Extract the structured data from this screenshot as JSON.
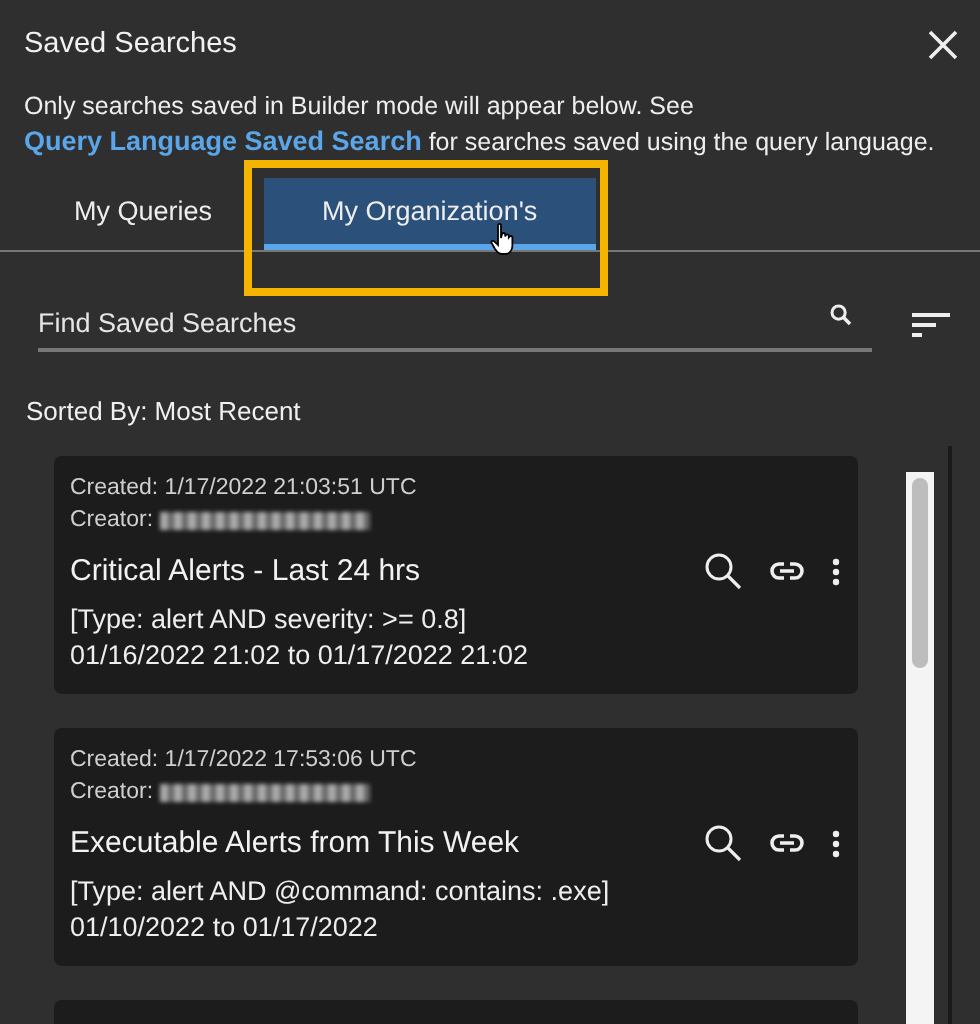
{
  "panel": {
    "title": "Saved Searches"
  },
  "notice": {
    "text": "Only searches saved in Builder mode will appear below. See ",
    "link": "Query Language Saved Search",
    "suffix": " for searches saved using the query language."
  },
  "tabs": [
    {
      "label": "My Queries",
      "selected": false
    },
    {
      "label": "My Organization's",
      "selected": true
    }
  ],
  "search": {
    "placeholder": "Find Saved Searches"
  },
  "sort_label": "Sorted By: Most Recent",
  "saved_searches": [
    {
      "created": "Created: 1/17/2022 21:03:51 UTC",
      "creator_label": "Creator:",
      "title": "Critical Alerts - Last 24 hrs",
      "query": "[Type: alert AND severity: >= 0.8]",
      "range": "01/16/2022 21:02 to 01/17/2022 21:02"
    },
    {
      "created": "Created: 1/17/2022 17:53:06 UTC",
      "creator_label": "Creator:",
      "title": "Executable Alerts from This Week",
      "query": "[Type: alert AND @command: contains: .exe]",
      "range": "01/10/2022 to 01/17/2022"
    }
  ]
}
